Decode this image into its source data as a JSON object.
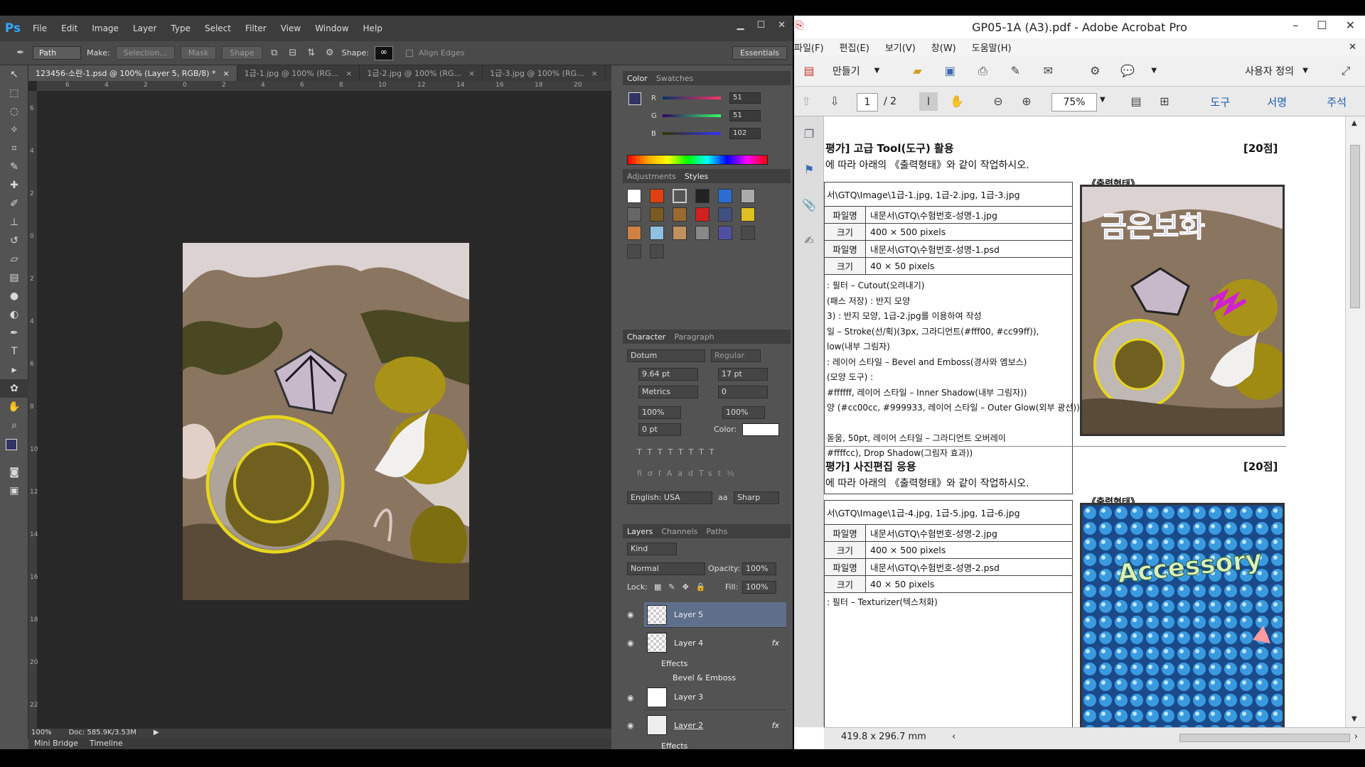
{
  "photoshop": {
    "logo": "Ps",
    "menu": [
      "File",
      "Edit",
      "Image",
      "Layer",
      "Type",
      "Select",
      "Filter",
      "View",
      "Window",
      "Help"
    ],
    "options": {
      "mode": "Path",
      "make_label": "Make:",
      "selection_btn": "Selection...",
      "mask_btn": "Mask",
      "shape_btn": "Shape",
      "shape_label": "Shape:",
      "align_edges": "Align Edges",
      "workspace": "Essentials"
    },
    "tabs": [
      {
        "label": "123456-소란-1.psd @ 100% (Layer 5, RGB/8) *"
      },
      {
        "label": "1급-1.jpg @ 100% (RG..."
      },
      {
        "label": "1급-2.jpg @ 100% (RG..."
      },
      {
        "label": "1급-3.jpg @ 100% (RG..."
      }
    ],
    "ruler_h": [
      "6",
      "4",
      "2",
      "0",
      "2",
      "4",
      "6",
      "8",
      "10",
      "12",
      "14",
      "16",
      "18",
      "20"
    ],
    "ruler_v": [
      "6",
      "4",
      "2",
      "0",
      "2",
      "4",
      "6",
      "8",
      "10",
      "12",
      "14",
      "16",
      "18",
      "20",
      "22"
    ],
    "status": {
      "zoom": "100%",
      "doc": "Doc: 585.9K/3.53M"
    },
    "bottom_tabs": [
      "Mini Bridge",
      "Timeline"
    ],
    "color_panel": {
      "tabs": [
        "Color",
        "Swatches"
      ],
      "r_label": "R",
      "r": "51",
      "g_label": "G",
      "g": "51",
      "b_label": "B",
      "b": "102",
      "foreground": "#333366"
    },
    "styles_panel": {
      "tabs": [
        "Adjustments",
        "Styles"
      ]
    },
    "character": {
      "tabs": [
        "Character",
        "Paragraph"
      ],
      "font": "Dotum",
      "style": "Regular",
      "size": "9.64 pt",
      "leading": "17 pt",
      "kerning": "Metrics",
      "tracking": "0",
      "vscale": "100%",
      "hscale": "100%",
      "baseline": "0 pt",
      "color_label": "Color:",
      "language": "English: USA",
      "aa": "Sharp",
      "aa_label": "aa"
    },
    "layers": {
      "tabs": [
        "Layers",
        "Channels",
        "Paths"
      ],
      "kind": "Kind",
      "blend": "Normal",
      "opacity_label": "Opacity:",
      "opacity": "100%",
      "lock_label": "Lock:",
      "fill_label": "Fill:",
      "fill": "100%",
      "items": [
        {
          "name": "Layer 5"
        },
        {
          "name": "Layer 4",
          "fx": "fx",
          "effects": "Effects",
          "effect": "Bevel & Emboss"
        },
        {
          "name": "Layer 3"
        },
        {
          "name": "Layer 2",
          "fx": "fx",
          "effects": "Effects"
        }
      ]
    }
  },
  "acrobat": {
    "title": "GP05-1A (A3).pdf - Adobe Acrobat Pro",
    "menu": [
      "파일(F)",
      "편집(E)",
      "보기(V)",
      "창(W)",
      "도움말(H)"
    ],
    "create_btn": "만들기",
    "customize": "사용자 정의",
    "page_current": "1",
    "page_total": "/ 2",
    "zoom": "75%",
    "tools": "도구",
    "sign": "서명",
    "comment": "주석",
    "status_size": "419.8 x 296.7 mm",
    "page": {
      "s1_title": "평가] 고급 Tool(도구) 활용",
      "s1_points": "[20점]",
      "s1_instr": "에 따라 아래의 《출력형태》와 같이 작업하시오.",
      "s1_output": "《출력형태》",
      "s1_source": "서\\GTQ\\Image\\1급-1.jpg, 1급-2.jpg, 1급-3.jpg",
      "s1_rows": [
        [
          "파일명",
          "내문서\\GTQ\\수험번호-성명-1.jpg"
        ],
        [
          "크기",
          "400 × 500 pixels"
        ],
        [
          "파일명",
          "내문서\\GTQ\\수험번호-성명-1.psd"
        ],
        [
          "크기",
          "40 × 50 pixels"
        ]
      ],
      "s1_specs": [
        ": 필터 – Cutout(오려내기)",
        "(패스 저장) : 반지 모양",
        "3) : 반지 모양, 1급-2.jpg를 이용하여 작성",
        "일 – Stroke(선/획)(3px, 그라디언트(#fff00, #cc99ff)),",
        "low(내부 그림자)",
        ": 레이어 스타일 – Bevel and Emboss(경사와 엠보스)",
        "(모양 도구) :",
        "#ffffff, 레이어 스타일 – Inner Shadow(내부 그림자))",
        "양 (#cc00cc, #999933, 레이어 스타일 – Outer Glow(외부 광선))",
        "",
        "돋움, 50pt, 레이어 스타일 – 그라디언트 오버레이",
        "#ffffcc), Drop Shadow(그림자 효과))"
      ],
      "s2_title": "평가] 사진편집 응용",
      "s2_points": "[20점]",
      "s2_instr": "에 따라 아래의 《출력형태》와 같이 작업하시오.",
      "s2_output": "《출력형태》",
      "s2_source": "서\\GTQ\\Image\\1급-4.jpg, 1급-5.jpg, 1급-6.jpg",
      "s2_rows": [
        [
          "파일명",
          "내문서\\GTQ\\수험번호-성명-2.jpg"
        ],
        [
          "크기",
          "400 × 500 pixels"
        ],
        [
          "파일명",
          "내문서\\GTQ\\수험번호-성명-2.psd"
        ],
        [
          "크기",
          "40 × 50 pixels"
        ]
      ],
      "s2_spec": ": 필터 – Texturizer(텍스처화)",
      "fig1_text": "금은보화",
      "fig2_text": "Accessory"
    }
  }
}
